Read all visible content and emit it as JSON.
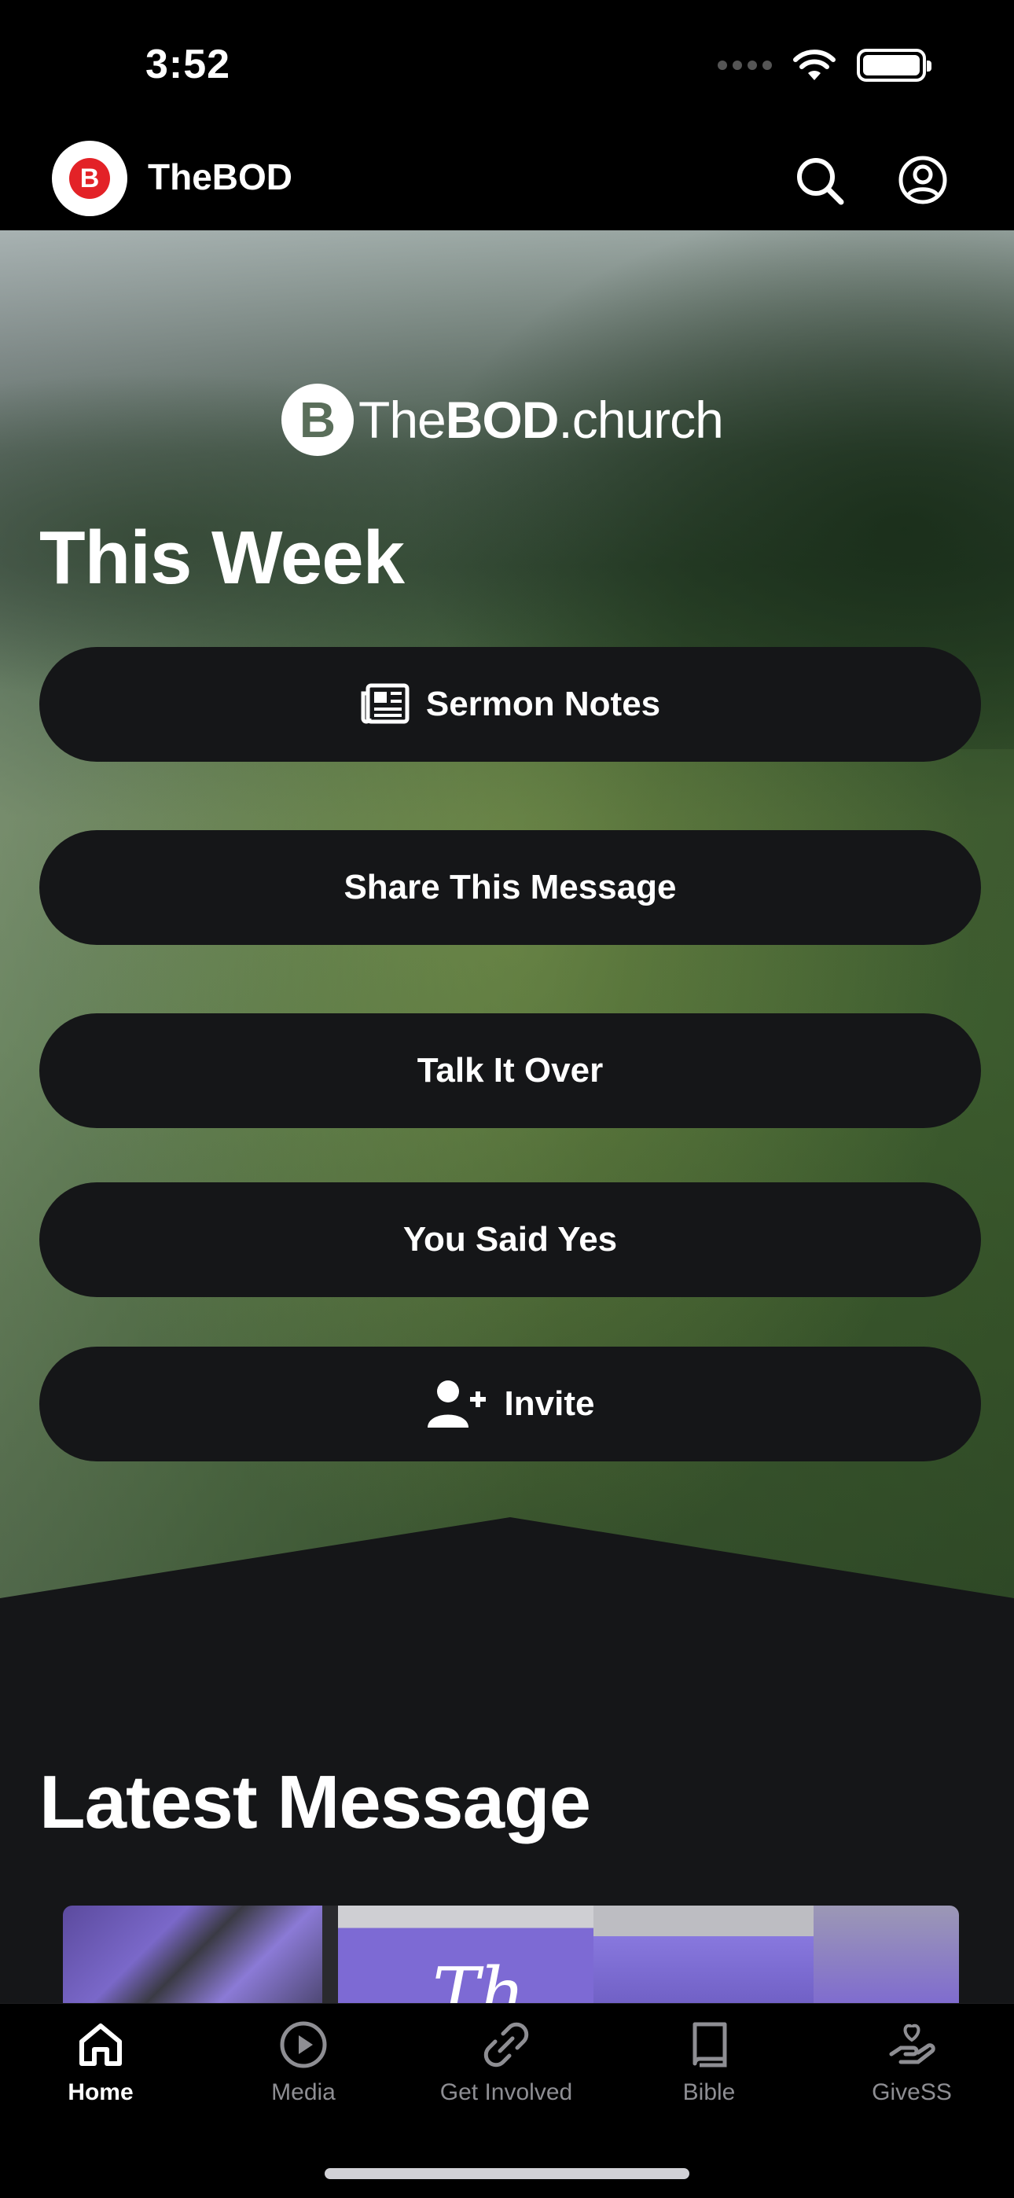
{
  "status_bar": {
    "time": "3:52"
  },
  "header": {
    "app_name": "TheBOD",
    "logo_letter": "B"
  },
  "hero": {
    "brand_prefix": "The",
    "brand_bold": "BOD",
    "brand_suffix": ".church",
    "section_title": "This Week",
    "buttons": [
      {
        "label": "Sermon Notes",
        "icon": "newspaper-icon"
      },
      {
        "label": "Share This Message"
      },
      {
        "label": "Talk It Over"
      },
      {
        "label": "You Said Yes"
      },
      {
        "label": "Invite",
        "icon": "user-plus-icon"
      }
    ]
  },
  "latest": {
    "section_title": "Latest Message",
    "thumbnail_script": "Th"
  },
  "tabs": [
    {
      "label": "Home",
      "icon": "home-icon",
      "active": true
    },
    {
      "label": "Media",
      "icon": "play-circle-icon",
      "active": false
    },
    {
      "label": "Get Involved",
      "icon": "link-icon",
      "active": false
    },
    {
      "label": "Bible",
      "icon": "book-icon",
      "active": false
    },
    {
      "label": "GiveSS",
      "icon": "give-hand-heart-icon",
      "active": false
    }
  ],
  "colors": {
    "background": "#000000",
    "button": "#151618",
    "brand_red": "#e32227",
    "tab_inactive": "#8e8e93"
  }
}
